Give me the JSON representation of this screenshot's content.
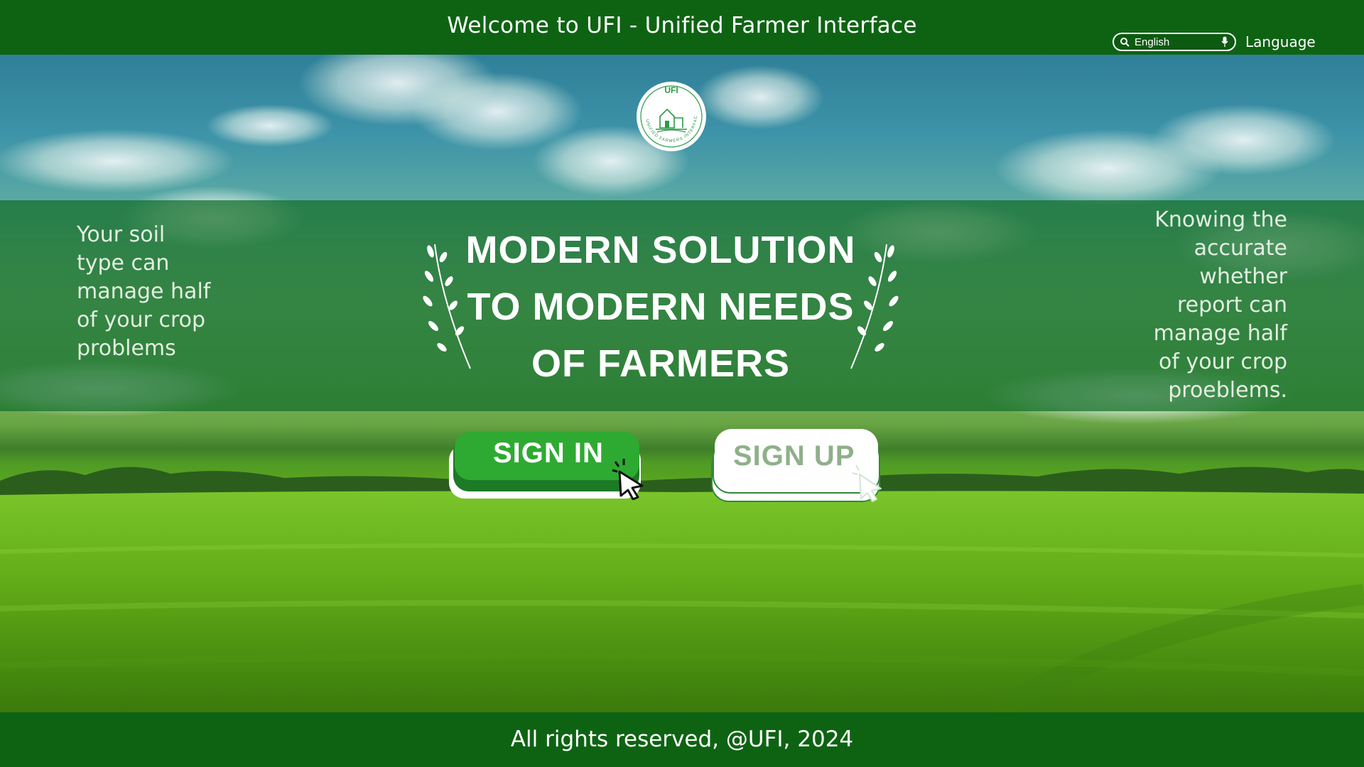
{
  "header": {
    "title": "Welcome to UFI - Unified Farmer Interface",
    "language_select": {
      "value": "English"
    },
    "language_label": "Language"
  },
  "logo": {
    "text": "UFI",
    "ring_text": "UNIFIED FARMERS INTERFACE"
  },
  "hero": {
    "headline": "MODERN SOLUTION TO MODERN NEEDS OF FARMERS",
    "left_text": "Your soil type can manage half of your crop problems",
    "right_text": "Knowing the accurate whether report  can manage half of your crop proeblems."
  },
  "buttons": {
    "signin": "SIGN IN",
    "signup": "SIGN UP"
  },
  "footer": {
    "text": "All rights reserved, @UFI, 2024"
  },
  "colors": {
    "brand_green": "#0e6313",
    "signin_green": "#2eaa32",
    "signup_text": "#8fb08a"
  },
  "icons": [
    "search-icon",
    "microphone-icon",
    "cursor-pointer-icon",
    "laurel-branch-icon"
  ]
}
